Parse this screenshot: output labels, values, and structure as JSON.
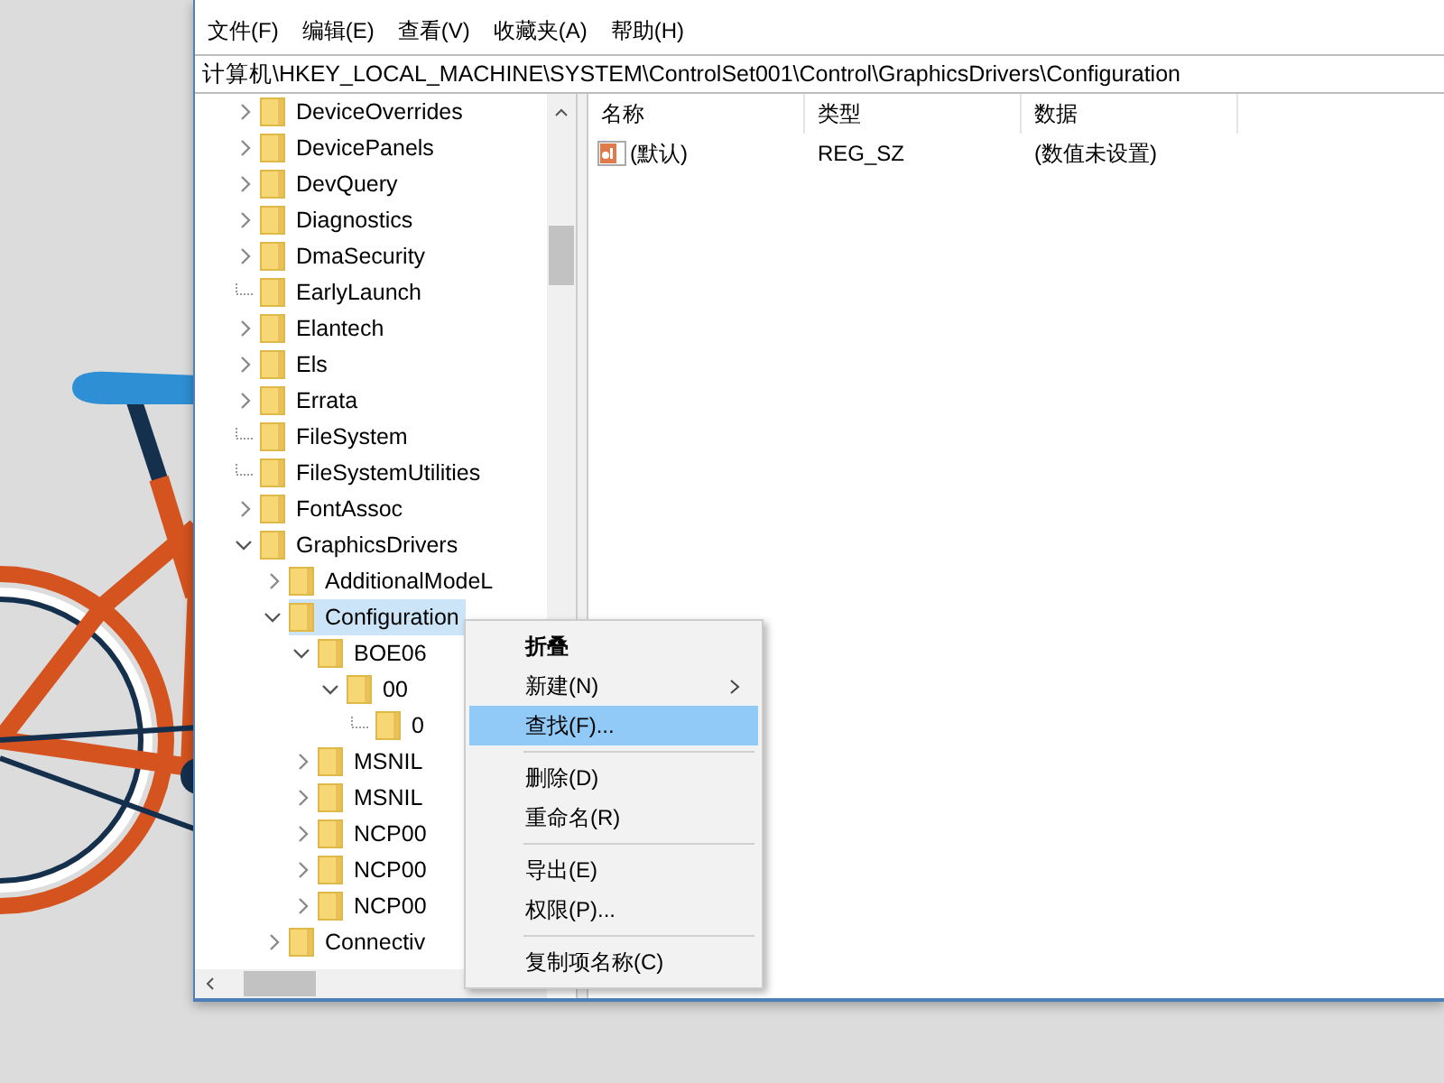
{
  "menu_bar": [
    "文件(F)",
    "编辑(E)",
    "查看(V)",
    "收藏夹(A)",
    "帮助(H)"
  ],
  "address": "计算机\\HKEY_LOCAL_MACHINE\\SYSTEM\\ControlSet001\\Control\\GraphicsDrivers\\Configuration",
  "tree": {
    "items": [
      {
        "label": "DeviceOverrides",
        "kind": "branch",
        "expanded": false,
        "selected": false
      },
      {
        "label": "DevicePanels",
        "kind": "branch",
        "expanded": false,
        "selected": false
      },
      {
        "label": "DevQuery",
        "kind": "branch",
        "expanded": false,
        "selected": false
      },
      {
        "label": "Diagnostics",
        "kind": "branch",
        "expanded": false,
        "selected": false
      },
      {
        "label": "DmaSecurity",
        "kind": "branch",
        "expanded": false,
        "selected": false
      },
      {
        "label": "EarlyLaunch",
        "kind": "leaf",
        "selected": false
      },
      {
        "label": "Elantech",
        "kind": "branch",
        "expanded": false,
        "selected": false
      },
      {
        "label": "Els",
        "kind": "branch",
        "expanded": false,
        "selected": false
      },
      {
        "label": "Errata",
        "kind": "branch",
        "expanded": false,
        "selected": false
      },
      {
        "label": "FileSystem",
        "kind": "leaf",
        "selected": false
      },
      {
        "label": "FileSystemUtilities",
        "kind": "leaf",
        "selected": false
      },
      {
        "label": "FontAssoc",
        "kind": "branch",
        "expanded": false,
        "selected": false
      },
      {
        "label": "GraphicsDrivers",
        "kind": "branch",
        "expanded": true,
        "selected": false,
        "children": [
          {
            "label": "AdditionalModeL",
            "kind": "branch",
            "expanded": false,
            "selected": false
          },
          {
            "label": "Configuration",
            "kind": "branch",
            "expanded": true,
            "selected": true,
            "children": [
              {
                "label": "BOE06",
                "kind": "branch",
                "expanded": true,
                "selected": false,
                "children": [
                  {
                    "label": "00",
                    "kind": "branch",
                    "expanded": true,
                    "selected": false,
                    "children": [
                      {
                        "label": "0",
                        "kind": "leaf",
                        "selected": false
                      }
                    ]
                  }
                ]
              },
              {
                "label": "MSNIL",
                "kind": "branch",
                "expanded": false,
                "selected": false
              },
              {
                "label": "MSNIL",
                "kind": "branch",
                "expanded": false,
                "selected": false
              },
              {
                "label": "NCP00",
                "kind": "branch",
                "expanded": false,
                "selected": false
              },
              {
                "label": "NCP00",
                "kind": "branch",
                "expanded": false,
                "selected": false
              },
              {
                "label": "NCP00",
                "kind": "branch",
                "expanded": false,
                "selected": false
              }
            ]
          },
          {
            "label": "Connectiv",
            "kind": "branch",
            "expanded": false,
            "selected": false
          }
        ]
      }
    ]
  },
  "values": {
    "columns": [
      "名称",
      "类型",
      "数据"
    ],
    "rows": [
      {
        "name": "(默认)",
        "type": "REG_SZ",
        "data": "(数值未设置)"
      }
    ]
  },
  "context_menu": [
    {
      "kind": "item",
      "label": "折叠",
      "bold": true,
      "submenu": false,
      "selected": false
    },
    {
      "kind": "item",
      "label": "新建(N)",
      "bold": false,
      "submenu": true,
      "selected": false
    },
    {
      "kind": "item",
      "label": "查找(F)...",
      "bold": false,
      "submenu": false,
      "selected": true
    },
    {
      "kind": "separator"
    },
    {
      "kind": "item",
      "label": "删除(D)",
      "bold": false,
      "submenu": false,
      "selected": false
    },
    {
      "kind": "item",
      "label": "重命名(R)",
      "bold": false,
      "submenu": false,
      "selected": false
    },
    {
      "kind": "separator"
    },
    {
      "kind": "item",
      "label": "导出(E)",
      "bold": false,
      "submenu": false,
      "selected": false
    },
    {
      "kind": "item",
      "label": "权限(P)...",
      "bold": false,
      "submenu": false,
      "selected": false
    },
    {
      "kind": "separator"
    },
    {
      "kind": "item",
      "label": "复制项名称(C)",
      "bold": false,
      "submenu": false,
      "selected": false
    }
  ]
}
